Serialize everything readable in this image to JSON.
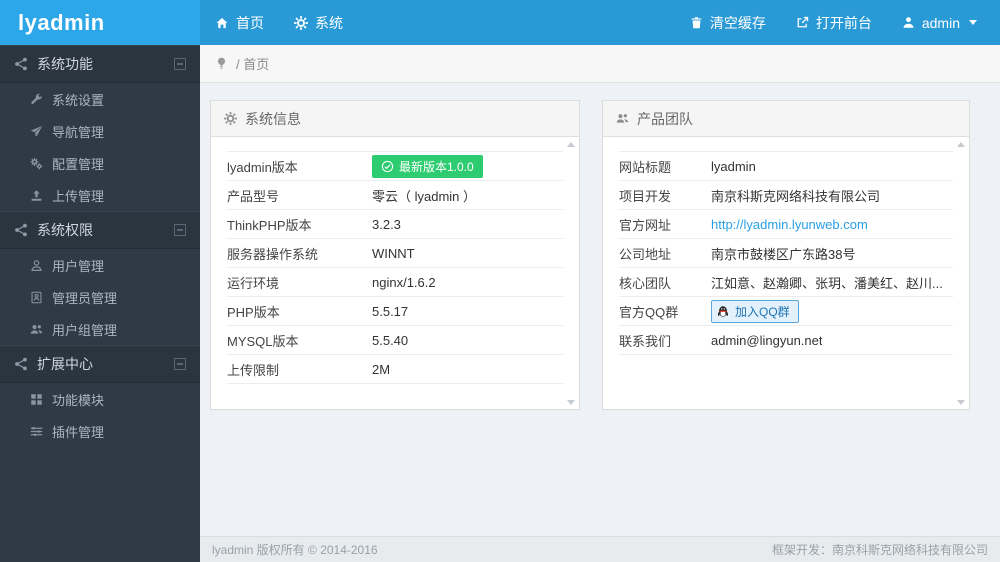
{
  "topbar": {
    "logo": "lyadmin",
    "nav": [
      {
        "icon": "home",
        "label": "首页"
      },
      {
        "icon": "gear",
        "label": "系统"
      }
    ],
    "actions": [
      {
        "icon": "trash",
        "label": "清空缓存"
      },
      {
        "icon": "external-link",
        "label": "打开前台"
      },
      {
        "icon": "user",
        "label": "admin"
      }
    ]
  },
  "sidebar": {
    "sections": [
      {
        "icon": "share",
        "label": "系统功能",
        "items": [
          {
            "icon": "wrench",
            "label": "系统设置"
          },
          {
            "icon": "paper-plane",
            "label": "导航管理"
          },
          {
            "icon": "cogs",
            "label": "配置管理"
          },
          {
            "icon": "upload",
            "label": "上传管理"
          }
        ]
      },
      {
        "icon": "share",
        "label": "系统权限",
        "items": [
          {
            "icon": "user",
            "label": "用户管理"
          },
          {
            "icon": "id-badge",
            "label": "管理员管理"
          },
          {
            "icon": "users",
            "label": "用户组管理"
          }
        ]
      },
      {
        "icon": "share",
        "label": "扩展中心",
        "items": [
          {
            "icon": "grid",
            "label": "功能模块"
          },
          {
            "icon": "sliders",
            "label": "插件管理"
          }
        ]
      }
    ]
  },
  "breadcrumb": {
    "icon": "lightbulb",
    "path": "/ 首页"
  },
  "panels": {
    "system_info": {
      "icon": "gear",
      "title": "系统信息",
      "rows": [
        {
          "label": "lyadmin版本",
          "value": "最新版本1.0.0",
          "type": "badge",
          "badge_color": "#2ecc71"
        },
        {
          "label": "产品型号",
          "value": "零云（ lyadmin ）"
        },
        {
          "label": "ThinkPHP版本",
          "value": "3.2.3"
        },
        {
          "label": "服务器操作系统",
          "value": "WINNT"
        },
        {
          "label": "运行环境",
          "value": "nginx/1.6.2"
        },
        {
          "label": "PHP版本",
          "value": "5.5.17"
        },
        {
          "label": "MYSQL版本",
          "value": "5.5.40"
        },
        {
          "label": "上传限制",
          "value": "2M"
        }
      ]
    },
    "team": {
      "icon": "team",
      "title": "产品团队",
      "rows": [
        {
          "label": "网站标题",
          "value": "lyadmin"
        },
        {
          "label": "项目开发",
          "value": "南京科斯克网络科技有限公司"
        },
        {
          "label": "官方网址",
          "value": "http://lyadmin.lyunweb.com",
          "type": "link"
        },
        {
          "label": "公司地址",
          "value": "南京市鼓楼区广东路38号"
        },
        {
          "label": "核心团队",
          "value": "江如意、赵瀚卿、张玥、潘美红、赵川..."
        },
        {
          "label": "官方QQ群",
          "value": "加入QQ群",
          "type": "qq-button"
        },
        {
          "label": "联系我们",
          "value": "admin@lingyun.net"
        }
      ]
    }
  },
  "footer": {
    "left": "lyadmin 版权所有 © 2014-2016",
    "right": "框架开发：南京科斯克网络科技有限公司"
  },
  "colors": {
    "topbar": "#2a9ad6",
    "logo_block": "#2ea7e9",
    "sidebar": "#2f3a46",
    "badge_green": "#2ecc71",
    "link_blue": "#2a9fe5"
  }
}
